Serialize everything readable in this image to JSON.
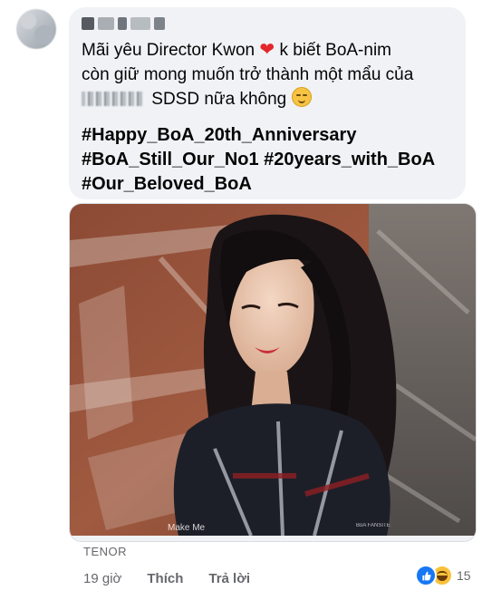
{
  "comment": {
    "author_name": "",
    "message_lines": [
      "Mãi yêu Director Kwon",
      "k biết BoA-nim",
      "còn giữ mong muốn trở thành một mẩu của",
      "SDSD nữa không"
    ],
    "hashtags": [
      "#Happy_BoA_20th_Anniversary",
      "#BoA_Still_Our_No1 #20years_with_BoA",
      "#Our_Beloved_BoA"
    ],
    "icons": {
      "avatar": "avatar-blurred",
      "heart": "red-heart-emoji",
      "relieved": "relieved-face-emoji"
    }
  },
  "attachment": {
    "provider": "TENOR",
    "caption": "Make Me",
    "credit": "BoA FANSITE"
  },
  "footer": {
    "time": "19 giờ",
    "like_label": "Thích",
    "reply_label": "Trả lời",
    "reaction_count": "15",
    "reaction_icons": [
      "like-icon",
      "haha-icon"
    ]
  },
  "colors": {
    "bubble_bg": "#f0f2f5",
    "like_blue": "#1877f2",
    "meta_gray": "#65676b"
  }
}
